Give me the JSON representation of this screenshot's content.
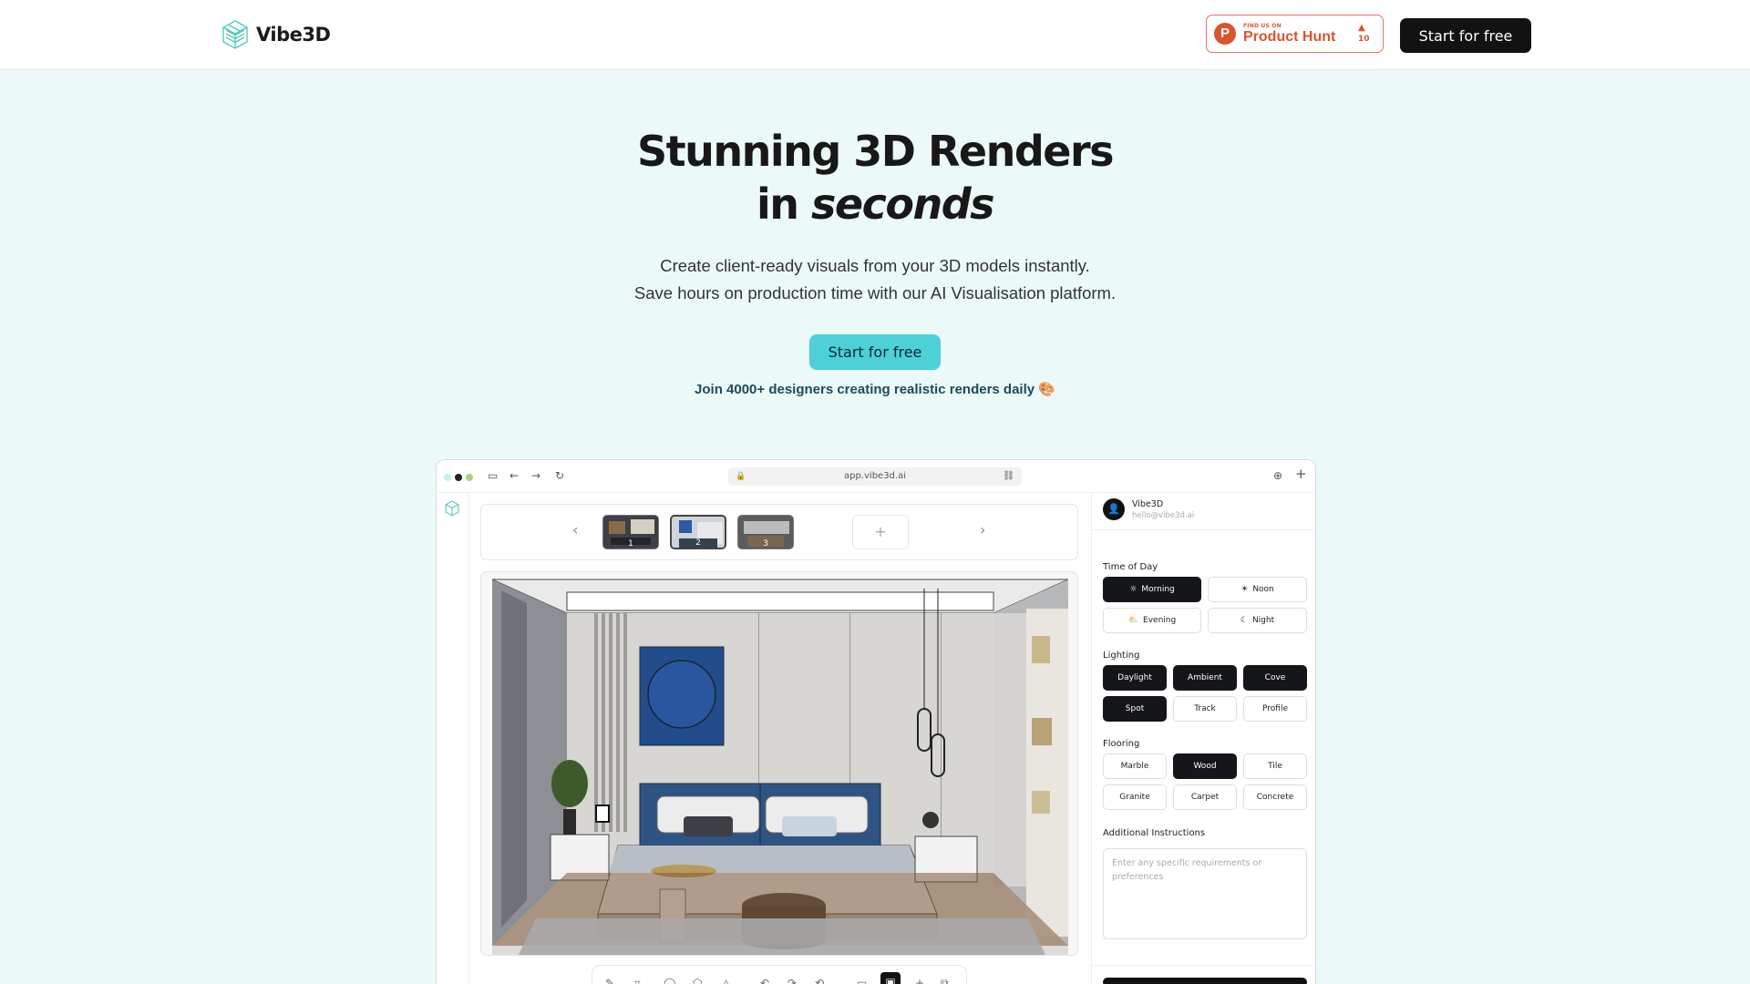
{
  "nav": {
    "brand": "Vibe3D",
    "product_hunt": {
      "small": "FIND US ON",
      "big": "Product Hunt",
      "count": "10"
    },
    "cta": "Start for free"
  },
  "hero": {
    "title_line1": "Stunning 3D Renders",
    "title_in": "in",
    "title_em": "seconds",
    "sub_line1": "Create client-ready visuals from your 3D models instantly.",
    "sub_line2": "Save hours on production time with our AI Visualisation platform.",
    "cta": "Start for free",
    "join": "Join 4000+ designers creating realistic renders daily 🎨"
  },
  "browser": {
    "url": "app.vibe3d.ai",
    "thumbnails": [
      "1",
      "2",
      "3"
    ],
    "add_label": "+"
  },
  "panel": {
    "user_name": "Vibe3D",
    "user_email": "hello@vibe3d.ai",
    "time_of_day_label": "Time of Day",
    "time_of_day": [
      {
        "label": "Morning",
        "active": true
      },
      {
        "label": "Noon",
        "active": false
      },
      {
        "label": "Evening",
        "active": false
      },
      {
        "label": "Night",
        "active": false
      }
    ],
    "lighting_label": "Lighting",
    "lighting": [
      {
        "label": "Daylight",
        "active": true
      },
      {
        "label": "Ambient",
        "active": true
      },
      {
        "label": "Cove",
        "active": true
      },
      {
        "label": "Spot",
        "active": true
      },
      {
        "label": "Track",
        "active": false
      },
      {
        "label": "Profile",
        "active": false
      }
    ],
    "flooring_label": "Flooring",
    "flooring": [
      {
        "label": "Marble",
        "active": false
      },
      {
        "label": "Wood",
        "active": true
      },
      {
        "label": "Tile",
        "active": false
      },
      {
        "label": "Granite",
        "active": false
      },
      {
        "label": "Carpet",
        "active": false
      },
      {
        "label": "Concrete",
        "active": false
      }
    ],
    "instructions_label": "Additional Instructions",
    "instructions_placeholder": "Enter any specific requirements or preferences"
  },
  "colors": {
    "accent": "#4dd0d8",
    "background": "#ecf9f9",
    "dark": "#121212",
    "product_hunt": "#da552f"
  }
}
